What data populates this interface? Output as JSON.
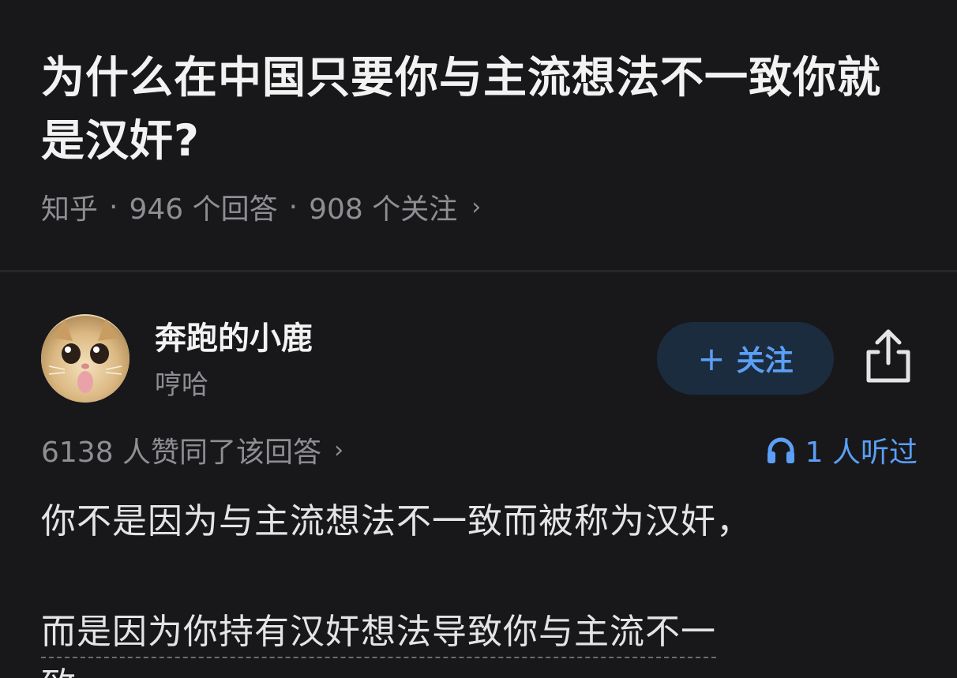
{
  "question": {
    "title": "为什么在中国只要你与主流想法不一致你就是汉奸?",
    "source": "知乎",
    "separator": "·",
    "answers": "946 个回答",
    "followers": "908 个关注",
    "chevron": "›"
  },
  "answer": {
    "author": {
      "name": "奔跑的小鹿",
      "bio": "哼哈",
      "avatar_icon": "cat-avatar"
    },
    "follow_button": {
      "plus": "+",
      "label": "关注"
    },
    "share_icon": "share-icon",
    "upvote_text": "6138 人赞同了该回答",
    "upvote_chevron": "›",
    "listen_icon": "headphones-icon",
    "listen_text": "1 人听过",
    "paragraphs": [
      "你不是因为与主流想法不一致而被称为汉奸，",
      "而是因为你持有汉奸想法导致你与主流不一",
      "致。"
    ]
  },
  "colors": {
    "background": "#18181b",
    "accent": "#5b9ff7",
    "follow_button_bg": "#1c2c3f",
    "secondary_text": "#8e8e93",
    "primary_text": "#f2f2f2"
  }
}
